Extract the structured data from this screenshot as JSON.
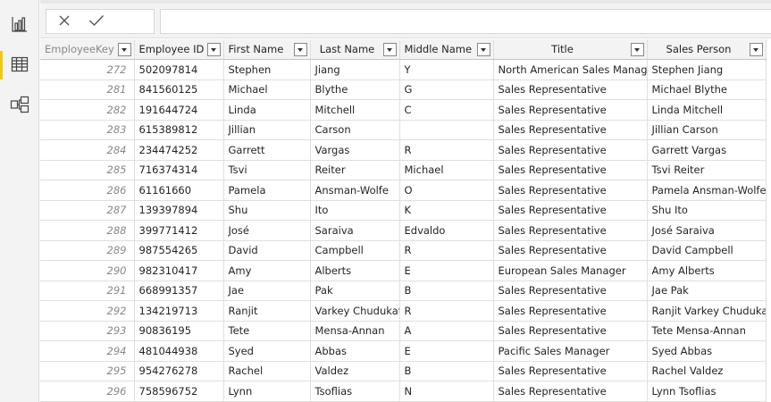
{
  "rail": {
    "items": [
      {
        "icon": "report-view-icon",
        "active": false
      },
      {
        "icon": "data-view-icon",
        "active": true
      },
      {
        "icon": "model-view-icon",
        "active": false
      }
    ]
  },
  "formula_bar": {
    "cancel_icon": "close-icon",
    "commit_icon": "checkmark-icon",
    "value": ""
  },
  "table": {
    "columns": [
      "EmployeeKey",
      "Employee ID",
      "First Name",
      "Last Name",
      "Middle Name",
      "Title",
      "Sales Person"
    ],
    "rows": [
      [
        "272",
        "502097814",
        "Stephen",
        "Jiang",
        "Y",
        "North American Sales Manager",
        "Stephen Jiang"
      ],
      [
        "281",
        "841560125",
        "Michael",
        "Blythe",
        "G",
        "Sales Representative",
        "Michael Blythe"
      ],
      [
        "282",
        "191644724",
        "Linda",
        "Mitchell",
        "C",
        "Sales Representative",
        "Linda Mitchell"
      ],
      [
        "283",
        "615389812",
        "Jillian",
        "Carson",
        "",
        "Sales Representative",
        "Jillian Carson"
      ],
      [
        "284",
        "234474252",
        "Garrett",
        "Vargas",
        "R",
        "Sales Representative",
        "Garrett Vargas"
      ],
      [
        "285",
        "716374314",
        "Tsvi",
        "Reiter",
        "Michael",
        "Sales Representative",
        "Tsvi Reiter"
      ],
      [
        "286",
        "61161660",
        "Pamela",
        "Ansman-Wolfe",
        "O",
        "Sales Representative",
        "Pamela Ansman-Wolfe"
      ],
      [
        "287",
        "139397894",
        "Shu",
        "Ito",
        "K",
        "Sales Representative",
        "Shu Ito"
      ],
      [
        "288",
        "399771412",
        "José",
        "Saraiva",
        "Edvaldo",
        "Sales Representative",
        "José Saraiva"
      ],
      [
        "289",
        "987554265",
        "David",
        "Campbell",
        "R",
        "Sales Representative",
        "David Campbell"
      ],
      [
        "290",
        "982310417",
        "Amy",
        "Alberts",
        "E",
        "European Sales Manager",
        "Amy Alberts"
      ],
      [
        "291",
        "668991357",
        "Jae",
        "Pak",
        "B",
        "Sales Representative",
        "Jae Pak"
      ],
      [
        "292",
        "134219713",
        "Ranjit",
        "Varkey Chudukatil",
        "R",
        "Sales Representative",
        "Ranjit Varkey Chudukatil"
      ],
      [
        "293",
        "90836195",
        "Tete",
        "Mensa-Annan",
        "A",
        "Sales Representative",
        "Tete Mensa-Annan"
      ],
      [
        "294",
        "481044938",
        "Syed",
        "Abbas",
        "E",
        "Pacific Sales Manager",
        "Syed Abbas"
      ],
      [
        "295",
        "954276278",
        "Rachel",
        "Valdez",
        "B",
        "Sales Representative",
        "Rachel Valdez"
      ],
      [
        "296",
        "758596752",
        "Lynn",
        "Tsoflias",
        "N",
        "Sales Representative",
        "Lynn Tsoflias"
      ]
    ]
  }
}
